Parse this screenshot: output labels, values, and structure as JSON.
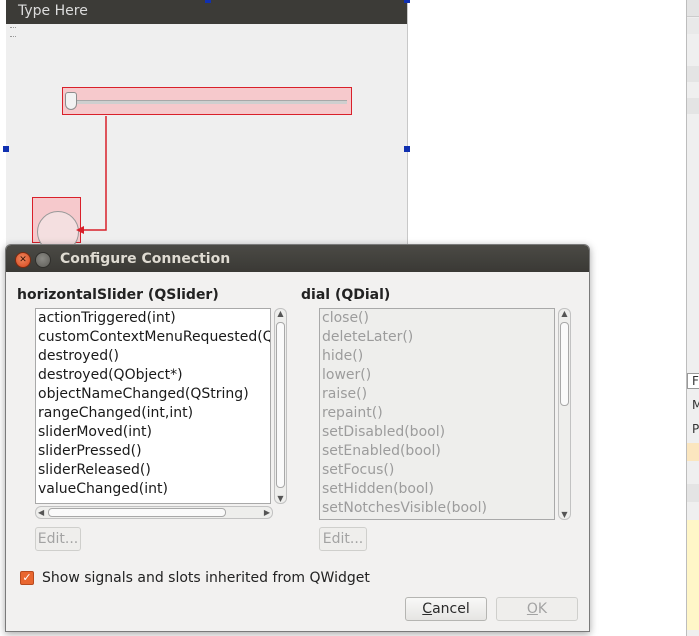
{
  "form": {
    "menu_placeholder": "Type Here"
  },
  "dialog": {
    "title": "Configure Connection",
    "sender": {
      "title": "horizontalSlider (QSlider)",
      "signals": [
        "actionTriggered(int)",
        "customContextMenuRequested(Q",
        "destroyed()",
        "destroyed(QObject*)",
        "objectNameChanged(QString)",
        "rangeChanged(int,int)",
        "sliderMoved(int)",
        "sliderPressed()",
        "sliderReleased()",
        "valueChanged(int)"
      ],
      "edit_label": "Edit..."
    },
    "receiver": {
      "title": "dial (QDial)",
      "slots": [
        "close()",
        "deleteLater()",
        "hide()",
        "lower()",
        "raise()",
        "repaint()",
        "setDisabled(bool)",
        "setEnabled(bool)",
        "setFocus()",
        "setHidden(bool)",
        "setNotchesVisible(bool)"
      ],
      "edit_label": "Edit..."
    },
    "show_inherited": {
      "checked": true,
      "label": "Show signals and slots inherited from QWidget"
    },
    "cancel_label": "Cancel",
    "ok_label": "OK"
  },
  "right_panel": {
    "labels": [
      "F",
      "M",
      "P"
    ]
  },
  "colors": {
    "accent": "#e9662f",
    "selection_red": "#d9202a",
    "titlebar": "#3c3b37"
  }
}
